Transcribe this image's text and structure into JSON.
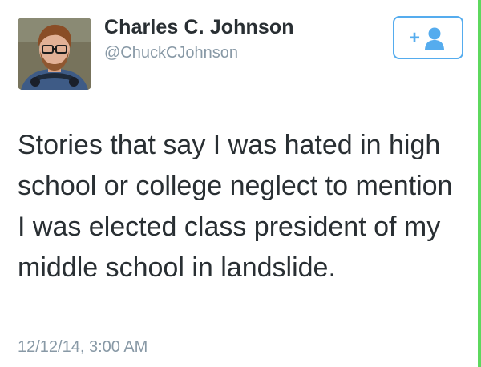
{
  "user": {
    "display_name": "Charles C. Johnson",
    "handle": "@ChuckCJohnson"
  },
  "follow_button": {
    "icon": "add-user-icon",
    "glyph": "+",
    "color": "#55acee"
  },
  "tweet": {
    "text": "Stories that say I was hated in high school or college neglect to mention I was elected class president of my middle school in landslide.",
    "timestamp": "12/12/14, 3:00 AM"
  },
  "colors": {
    "name": "#292f33",
    "secondary": "#8899a6",
    "accent": "#55acee",
    "edge": "#5ed85e"
  }
}
